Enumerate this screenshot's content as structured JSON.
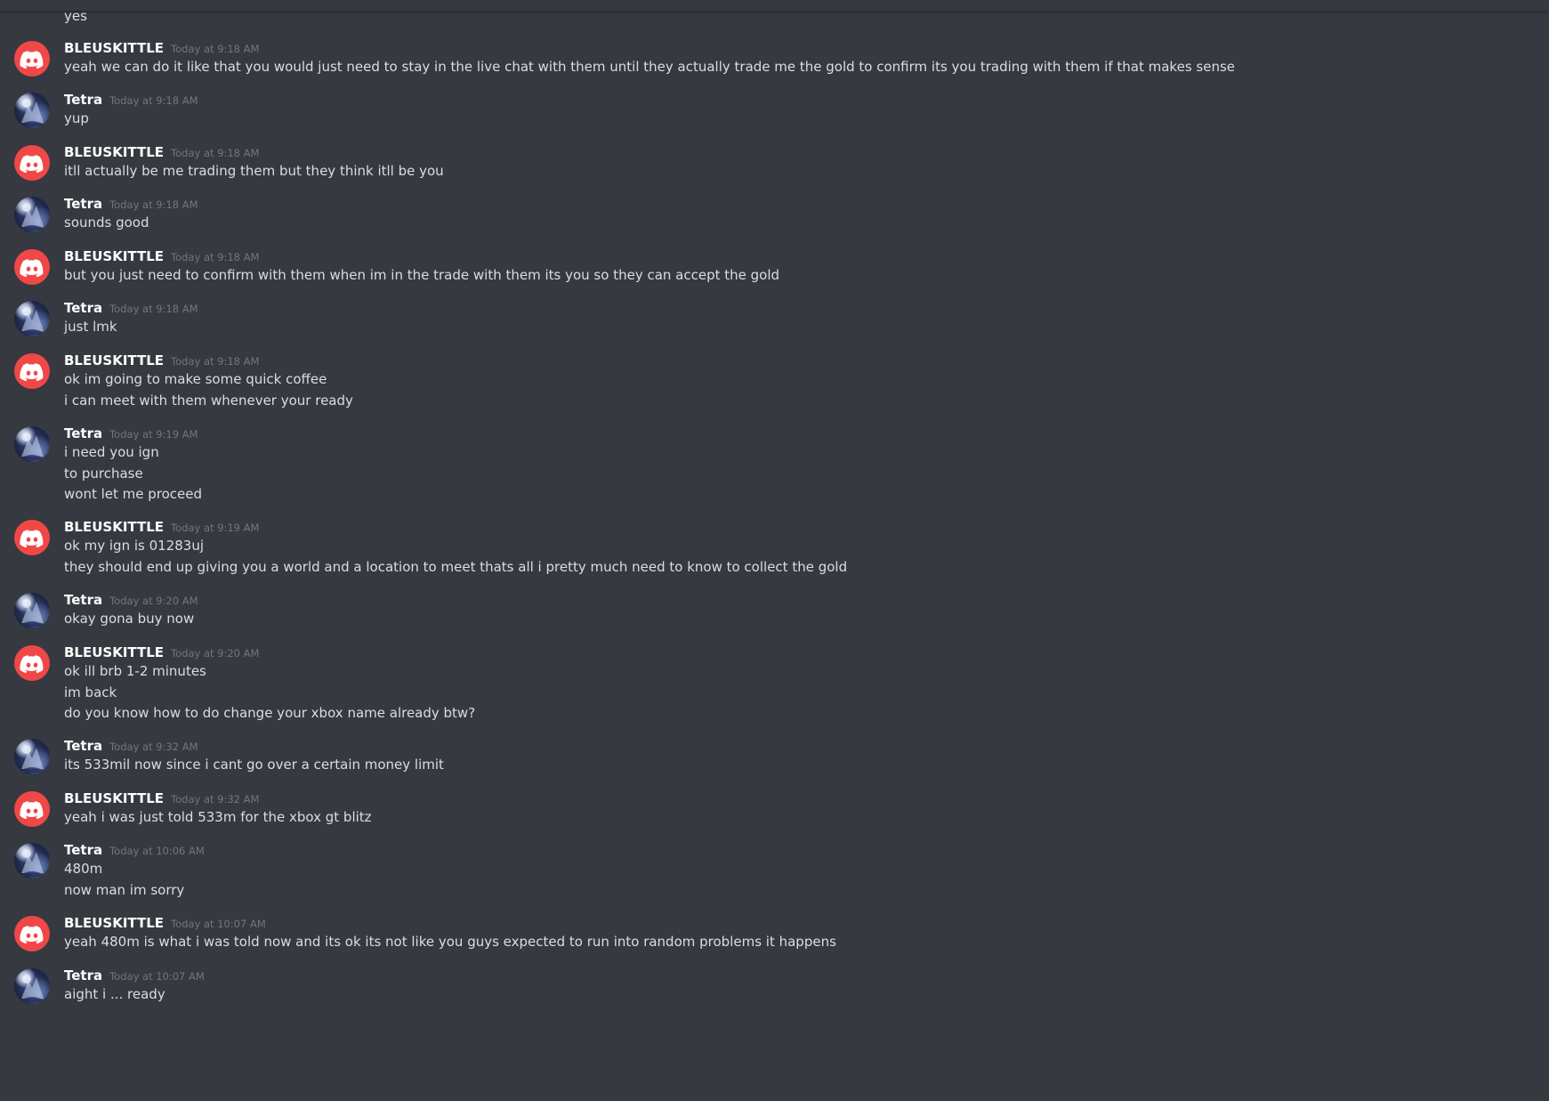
{
  "top_message": "yes",
  "groups": [
    {
      "author": "BLEUSKITTLE",
      "avatar": "discord-logo-icon",
      "time": "Today at 9:18 AM",
      "lines": [
        "yeah we can do it like that you would just need to stay in the live chat with them until they actually trade me the gold to confirm its you trading with them if that makes sense"
      ]
    },
    {
      "author": "Tetra",
      "avatar": "user-avatar-icon",
      "time": "Today at 9:18 AM",
      "lines": [
        "yup"
      ]
    },
    {
      "author": "BLEUSKITTLE",
      "avatar": "discord-logo-icon",
      "time": "Today at 9:18 AM",
      "lines": [
        "itll actually be me trading them but they think itll be you"
      ]
    },
    {
      "author": "Tetra",
      "avatar": "user-avatar-icon",
      "time": "Today at 9:18 AM",
      "lines": [
        "sounds good"
      ]
    },
    {
      "author": "BLEUSKITTLE",
      "avatar": "discord-logo-icon",
      "time": "Today at 9:18 AM",
      "lines": [
        "but you just need to confirm with them when im in the trade with them its you so they can accept the gold"
      ]
    },
    {
      "author": "Tetra",
      "avatar": "user-avatar-icon",
      "time": "Today at 9:18 AM",
      "lines": [
        "just lmk"
      ]
    },
    {
      "author": "BLEUSKITTLE",
      "avatar": "discord-logo-icon",
      "time": "Today at 9:18 AM",
      "lines": [
        "ok im going to make some quick coffee",
        "i can meet with them whenever your ready"
      ]
    },
    {
      "author": "Tetra",
      "avatar": "user-avatar-icon",
      "time": "Today at 9:19 AM",
      "lines": [
        "i need you ign",
        "to purchase",
        "wont let me proceed"
      ]
    },
    {
      "author": "BLEUSKITTLE",
      "avatar": "discord-logo-icon",
      "time": "Today at 9:19 AM",
      "lines": [
        "ok my ign is 01283uj",
        "they should end up giving you a world and a location to meet thats all i pretty much need to know to collect the gold"
      ]
    },
    {
      "author": "Tetra",
      "avatar": "user-avatar-icon",
      "time": "Today at 9:20 AM",
      "lines": [
        "okay gona buy now"
      ]
    },
    {
      "author": "BLEUSKITTLE",
      "avatar": "discord-logo-icon",
      "time": "Today at 9:20 AM",
      "lines": [
        "ok ill brb 1-2 minutes",
        "im back",
        "do you know how to do change your xbox name already btw?"
      ]
    },
    {
      "author": "Tetra",
      "avatar": "user-avatar-icon",
      "time": "Today at 9:32 AM",
      "lines": [
        "its 533mil now since i cant go over a certain money limit"
      ]
    },
    {
      "author": "BLEUSKITTLE",
      "avatar": "discord-logo-icon",
      "time": "Today at 9:32 AM",
      "lines": [
        "yeah i was just told 533m for the xbox gt blitz"
      ]
    },
    {
      "author": "Tetra",
      "avatar": "user-avatar-icon",
      "time": "Today at 10:06 AM",
      "lines": [
        "480m",
        "now man im sorry"
      ]
    },
    {
      "author": "BLEUSKITTLE",
      "avatar": "discord-logo-icon",
      "time": "Today at 10:07 AM",
      "lines": [
        "yeah 480m is what i was told now and its ok its not like you guys expected to run into random problems it happens"
      ]
    },
    {
      "author": "Tetra",
      "avatar": "user-avatar-icon",
      "time": "Today at 10:07 AM",
      "lines": [
        "aight i ... ready"
      ]
    }
  ],
  "colors": {
    "background": "#36393f",
    "discord_avatar": "#f04747",
    "username": "#ffffff",
    "timestamp": "#72767d",
    "message_text": "#dcddde"
  }
}
